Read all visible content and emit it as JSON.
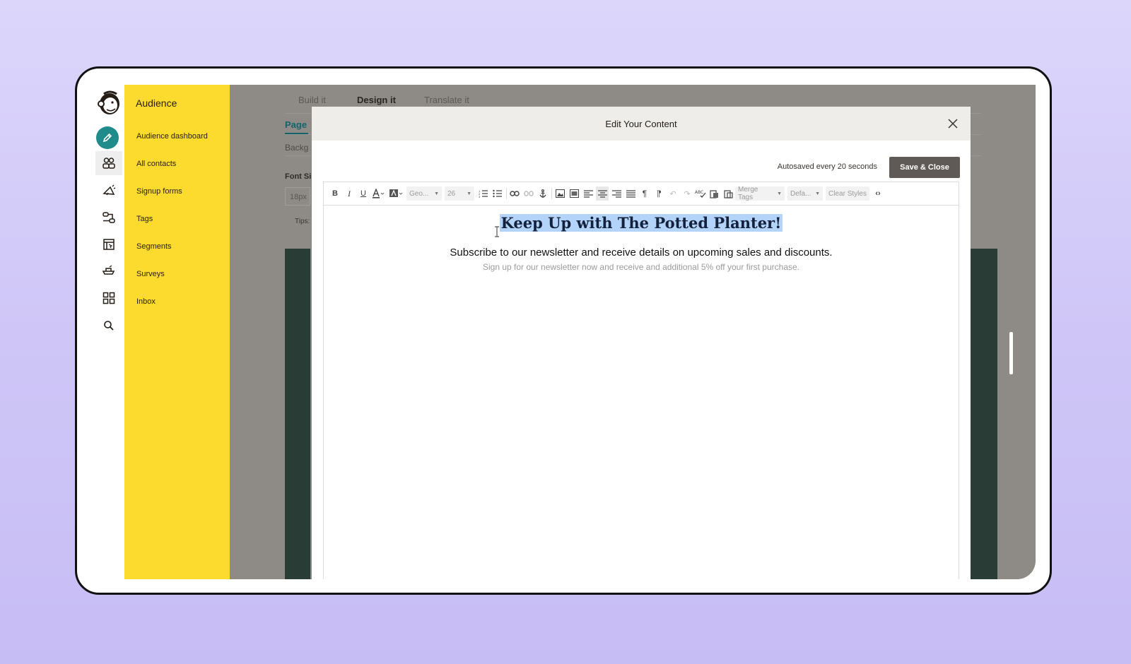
{
  "sidebar": {
    "title": "Audience",
    "items": [
      {
        "label": "Audience dashboard"
      },
      {
        "label": "All contacts"
      },
      {
        "label": "Signup forms"
      },
      {
        "label": "Tags"
      },
      {
        "label": "Segments"
      },
      {
        "label": "Surveys"
      },
      {
        "label": "Inbox"
      }
    ]
  },
  "rail": {
    "icons": [
      "mailchimp-logo-icon",
      "pencil-icon",
      "audience-icon",
      "campaigns-icon",
      "automations-icon",
      "website-icon",
      "integrations-icon",
      "grid-icon",
      "search-icon"
    ],
    "accent": "#1f8b8a"
  },
  "background": {
    "tabs": [
      {
        "label": "Build it"
      },
      {
        "label": "Design it"
      },
      {
        "label": "Translate it"
      }
    ],
    "active_tab": "Design it",
    "page_tab": "Page",
    "background_label": "Backg",
    "font_size_label": "Font Si",
    "font_size_value": "18px",
    "tips_label": "Tips:",
    "green": "#293c35"
  },
  "modal": {
    "title": "Edit Your Content",
    "autosave_text": "Autosaved every 20 seconds",
    "save_label": "Save & Close",
    "toolbar": {
      "font_family": "Geo...",
      "font_size": "26",
      "merge_tags": "Merge Tags",
      "default": "Defa...",
      "clear_styles": "Clear Styles"
    },
    "content": {
      "headline": "Keep Up with The Potted Planter!",
      "subhead": "Subscribe to our newsletter and receive details on upcoming sales and discounts.",
      "small_text": "Sign up for our newsletter now and receive and additional 5% off your first purchase."
    },
    "selection_color": "#b3d4f8"
  }
}
